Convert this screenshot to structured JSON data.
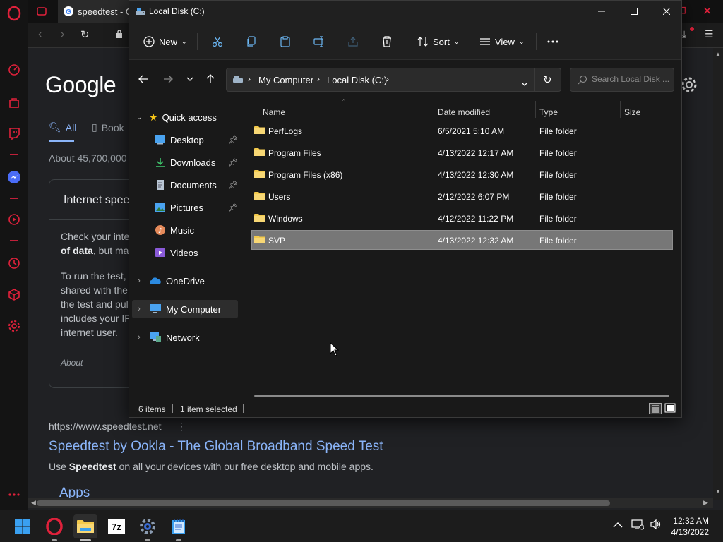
{
  "browser": {
    "tab_title": "speedtest - Go",
    "google": {
      "logo": "Google",
      "tab_all": "All",
      "tab_books": "Book",
      "result_count": "About 45,700,000",
      "card_title": "Internet spee",
      "card_para1_a": "Check your inte",
      "card_para1_b_bold": "of data",
      "card_para1_c": ", but ma",
      "card_para2_line1": "To run the test,",
      "card_para2_line2": "shared with the",
      "card_para2_line3": "the test and pul",
      "card_para2_line4": "includes your IP",
      "card_para2_line5": "internet user.",
      "card_about": "About",
      "result_url": "https://www.speedtest.net",
      "result_title": "Speedtest by Ookla - The Global Broadband Speed Test",
      "result_snippet_a": "Use ",
      "result_snippet_bold": "Speedtest",
      "result_snippet_b": " on all your devices with our free desktop and mobile apps.",
      "apps_heading": "Apps"
    }
  },
  "explorer": {
    "title": "Local Disk (C:)",
    "toolbar": {
      "new_label": "New",
      "sort_label": "Sort",
      "view_label": "View"
    },
    "breadcrumb": [
      "My Computer",
      "Local Disk (C:)"
    ],
    "search_placeholder": "Search Local Disk ...",
    "nav_pane": {
      "quick_access": "Quick access",
      "items": [
        {
          "label": "Desktop",
          "pinned": true
        },
        {
          "label": "Downloads",
          "pinned": true
        },
        {
          "label": "Documents",
          "pinned": true
        },
        {
          "label": "Pictures",
          "pinned": true
        },
        {
          "label": "Music",
          "pinned": false
        },
        {
          "label": "Videos",
          "pinned": false
        }
      ],
      "onedrive": "OneDrive",
      "my_computer": "My Computer",
      "network": "Network"
    },
    "columns": {
      "name": "Name",
      "date": "Date modified",
      "type": "Type",
      "size": "Size"
    },
    "files": [
      {
        "name": "PerfLogs",
        "date": "6/5/2021 5:10 AM",
        "type": "File folder",
        "selected": false
      },
      {
        "name": "Program Files",
        "date": "4/13/2022 12:17 AM",
        "type": "File folder",
        "selected": false
      },
      {
        "name": "Program Files (x86)",
        "date": "4/13/2022 12:30 AM",
        "type": "File folder",
        "selected": false
      },
      {
        "name": "Users",
        "date": "2/12/2022 6:07 PM",
        "type": "File folder",
        "selected": false
      },
      {
        "name": "Windows",
        "date": "4/12/2022 11:22 PM",
        "type": "File folder",
        "selected": false
      },
      {
        "name": "SVP",
        "date": "4/13/2022 12:32 AM",
        "type": "File folder",
        "selected": true
      }
    ],
    "status": {
      "item_count": "6 items",
      "selected": "1 item selected"
    }
  },
  "taskbar": {
    "time": "12:32 AM",
    "date": "4/13/2022",
    "apps": [
      "start-icon",
      "opera-icon",
      "file-explorer-icon",
      "7zip-icon",
      "settings-icon",
      "notepad-icon"
    ],
    "sevenzip_label": "7z"
  },
  "colors": {
    "opera_red": "#e0213b",
    "folder_yellow": "#f2c94c",
    "google_link": "#8ab4f8",
    "selection": "#777777"
  }
}
